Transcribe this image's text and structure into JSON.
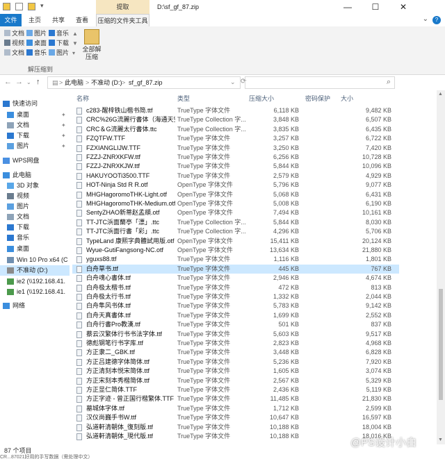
{
  "window": {
    "title": "D:\\sf_gf_87.zip",
    "context_tab": "提取",
    "minimize": "—",
    "maximize": "☐",
    "close": "✕"
  },
  "ribbon_tabs": [
    "文件",
    "主页",
    "共享",
    "查看",
    "压缩的文件夹工具"
  ],
  "ribbon": {
    "targets": [
      [
        "文档",
        "图片",
        "音乐"
      ],
      [
        "视频",
        "桌面",
        "下载"
      ],
      [
        "文档",
        "音乐",
        "图片"
      ]
    ],
    "extract_all": [
      "全部解",
      "压缩"
    ],
    "group_label": "解压缩到"
  },
  "address": {
    "crumbs": [
      "此电脑",
      "不准动 (D:)",
      "sf_gf_87.zip"
    ],
    "separator": ">"
  },
  "navpane": {
    "items": [
      {
        "label": "快速访问",
        "icon": "star-icon",
        "color": "#2b78d0"
      },
      {
        "label": "桌面",
        "icon": "desktop-icon",
        "color": "#3b8ede",
        "pin": true
      },
      {
        "label": "文档",
        "icon": "documents-icon",
        "color": "#8ea3b8",
        "pin": true
      },
      {
        "label": "下载",
        "icon": "download-icon",
        "color": "#2b78d0",
        "pin": true
      },
      {
        "label": "图片",
        "icon": "pictures-icon",
        "color": "#5ba0e0",
        "pin": true
      },
      {
        "label": "WPS网盘",
        "icon": "cloud-icon",
        "color": "#4a90e2"
      },
      {
        "label": "此电脑",
        "icon": "computer-icon",
        "color": "#3b8ede"
      },
      {
        "label": "3D 对象",
        "icon": "cube-icon",
        "color": "#59a7e8"
      },
      {
        "label": "视频",
        "icon": "video-icon",
        "color": "#6a7c8e"
      },
      {
        "label": "图片",
        "icon": "pictures-icon",
        "color": "#5ba0e0"
      },
      {
        "label": "文档",
        "icon": "documents-icon",
        "color": "#8ea3b8"
      },
      {
        "label": "下载",
        "icon": "download-icon",
        "color": "#2b78d0"
      },
      {
        "label": "音乐",
        "icon": "music-icon",
        "color": "#2b78d0"
      },
      {
        "label": "桌面",
        "icon": "desktop-icon",
        "color": "#3b8ede"
      },
      {
        "label": "Win 10 Pro x64 (C",
        "icon": "drive-icon",
        "color": "#6f8fb0"
      },
      {
        "label": "不准动 (D:)",
        "icon": "drive-icon",
        "color": "#8a8a8a"
      },
      {
        "label": "ie2 (\\\\192.168.41.",
        "icon": "network-drive-icon",
        "color": "#4c9a4c"
      },
      {
        "label": "ie1 (\\\\192.168.41.",
        "icon": "network-drive-icon",
        "color": "#4c9a4c"
      },
      {
        "label": "网络",
        "icon": "network-icon",
        "color": "#3b8ede"
      }
    ]
  },
  "columns": [
    "名称",
    "类型",
    "压缩大小",
    "密码保护",
    "大小"
  ],
  "files": [
    {
      "name": "c283-醒梓铁山楷书简.ttf",
      "type": "TrueType 字体文件",
      "csize": "6,118 KB",
      "size": "9,482 KB"
    },
    {
      "name": "CRC%26G流麗行書体（海通天空）...",
      "type": "TrueType Collection 字...",
      "csize": "3,848 KB",
      "size": "6,507 KB"
    },
    {
      "name": "CRC＆G流麗太行書体.ttc",
      "type": "TrueType Collection 字...",
      "csize": "3,835 KB",
      "size": "6,435 KB"
    },
    {
      "name": "FZQTFW.TTF",
      "type": "TrueType 字体文件",
      "csize": "3,257 KB",
      "size": "6,722 KB"
    },
    {
      "name": "FZXIANGLIJW.TTF",
      "type": "TrueType 字体文件",
      "csize": "3,250 KB",
      "size": "7,420 KB"
    },
    {
      "name": "FZZJ-ZNRXKFW.ttf",
      "type": "TrueType 字体文件",
      "csize": "6,256 KB",
      "size": "10,728 KB"
    },
    {
      "name": "FZZJ-ZNRXKJW.ttf",
      "type": "TrueType 字体文件",
      "csize": "5,844 KB",
      "size": "10,096 KB"
    },
    {
      "name": "HAKUYOOTi3500.TTF",
      "type": "TrueType 字体文件",
      "csize": "2,579 KB",
      "size": "4,929 KB"
    },
    {
      "name": "HOT-Ninja Std R R.otf",
      "type": "OpenType 字体文件",
      "csize": "5,796 KB",
      "size": "9,077 KB"
    },
    {
      "name": "MHGHagoromoTHK-Light.otf",
      "type": "OpenType 字体文件",
      "csize": "5,068 KB",
      "size": "6,431 KB"
    },
    {
      "name": "MHGHagoromoTHK-Medium.otf",
      "type": "OpenType 字体文件",
      "csize": "5,008 KB",
      "size": "6,190 KB"
    },
    {
      "name": "SentyZHAO新蒂赵孟頫.otf",
      "type": "OpenType 字体文件",
      "csize": "7,494 KB",
      "size": "10,161 KB"
    },
    {
      "name": "TT-JTC浜面蘭亭「漂」.ttc",
      "type": "TrueType Collection 字...",
      "csize": "5,844 KB",
      "size": "8,030 KB"
    },
    {
      "name": "TT-JTC浜面行書「彩」.ttc",
      "type": "TrueType Collection 字...",
      "csize": "4,296 KB",
      "size": "5,706 KB"
    },
    {
      "name": "TypeLand 康熙字典體試用版.otf",
      "type": "OpenType 字体文件",
      "csize": "15,411 KB",
      "size": "20,124 KB"
    },
    {
      "name": "Wyue-GutiFangsong-NC.otf",
      "type": "OpenType 字体文件",
      "csize": "13,634 KB",
      "size": "21,880 KB"
    },
    {
      "name": "yguxs88.ttf",
      "type": "TrueType 字体文件",
      "csize": "1,116 KB",
      "size": "1,801 KB"
    },
    {
      "name": "白舟草书.ttf",
      "type": "TrueType 字体文件",
      "csize": "445 KB",
      "size": "767 KB",
      "selected": true
    },
    {
      "name": "白舟魂心書体.ttf",
      "type": "TrueType 字体文件",
      "csize": "2,946 KB",
      "size": "4,674 KB"
    },
    {
      "name": "白舟极太楷书.ttf",
      "type": "TrueType 字体文件",
      "csize": "472 KB",
      "size": "813 KB"
    },
    {
      "name": "白舟极太行书.ttf",
      "type": "TrueType 字体文件",
      "csize": "1,332 KB",
      "size": "2,044 KB"
    },
    {
      "name": "白舟隼风书体.ttf",
      "type": "TrueType 字体文件",
      "csize": "5,783 KB",
      "size": "9,142 KB"
    },
    {
      "name": "白舟天真書体.ttf",
      "type": "TrueType 字体文件",
      "csize": "1,699 KB",
      "size": "2,552 KB"
    },
    {
      "name": "白舟行書Pro教漢.ttf",
      "type": "TrueType 字体文件",
      "csize": "501 KB",
      "size": "837 KB"
    },
    {
      "name": "蔡云汉繁体行书书法字体.ttf",
      "type": "TrueType 字体文件",
      "csize": "5,603 KB",
      "size": "9,517 KB"
    },
    {
      "name": "德彪钢笔行书字库.ttf",
      "type": "TrueType 字体文件",
      "csize": "2,823 KB",
      "size": "4,968 KB"
    },
    {
      "name": "方正隶二_GBK.ttf",
      "type": "TrueType 字体文件",
      "csize": "3,448 KB",
      "size": "6,828 KB"
    },
    {
      "name": "方正吕建德字体简体.ttf",
      "type": "TrueType 字体文件",
      "csize": "5,236 KB",
      "size": "7,920 KB"
    },
    {
      "name": "方正清刻本悦宋简体.ttf",
      "type": "TrueType 字体文件",
      "csize": "1,605 KB",
      "size": "3,074 KB"
    },
    {
      "name": "方正宋刻本秀楷简体.ttf",
      "type": "TrueType 字体文件",
      "csize": "2,567 KB",
      "size": "5,329 KB"
    },
    {
      "name": "方正显仁简体.TTF",
      "type": "TrueType 字体文件",
      "csize": "2,436 KB",
      "size": "5,119 KB"
    },
    {
      "name": "方正字迹 - 曾正国行楷繁体.TTF",
      "type": "TrueType 字体文件",
      "csize": "11,485 KB",
      "size": "21,830 KB"
    },
    {
      "name": "墓城体字体.ttf",
      "type": "TrueType 字体文件",
      "csize": "1,712 KB",
      "size": "2,599 KB"
    },
    {
      "name": "汉仪尚巍手书W.ttf",
      "type": "TrueType 字体文件",
      "csize": "10,647 KB",
      "size": "16,597 KB"
    },
    {
      "name": "弘道軒清朝体_復刻版.ttf",
      "type": "TrueType 字体文件",
      "csize": "10,188 KB",
      "size": "18,004 KB"
    },
    {
      "name": "弘道軒清朝体_現代版.ttf",
      "type": "TrueType 字体文件",
      "csize": "10,188 KB",
      "size": "18,016 KB"
    }
  ],
  "status": {
    "count": "87 个项目",
    "hint": "CR...87021好用的手写数据（需处理中文）"
  },
  "watermark": "@PS设计小白",
  "colors": {
    "accent": "#1979ca",
    "selection": "#cce8ff",
    "context_tab": "#f6e6c1"
  }
}
